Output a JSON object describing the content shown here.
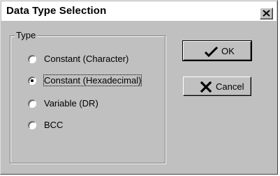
{
  "dialog": {
    "title": "Data Type Selection"
  },
  "group": {
    "label": "Type"
  },
  "options": [
    {
      "label": "Constant (Character)",
      "selected": false
    },
    {
      "label": "Constant (Hexadecimal)",
      "selected": true
    },
    {
      "label": "Variable (DR)",
      "selected": false
    },
    {
      "label": "BCC",
      "selected": false
    }
  ],
  "buttons": {
    "ok_label": "OK",
    "ok_icon": "checkmark-icon",
    "cancel_label": "Cancel",
    "cancel_icon": "x-cross-icon"
  },
  "colors": {
    "face": "#c0c0c0",
    "titlebar": "#ffffff",
    "check_green": "#000000"
  }
}
